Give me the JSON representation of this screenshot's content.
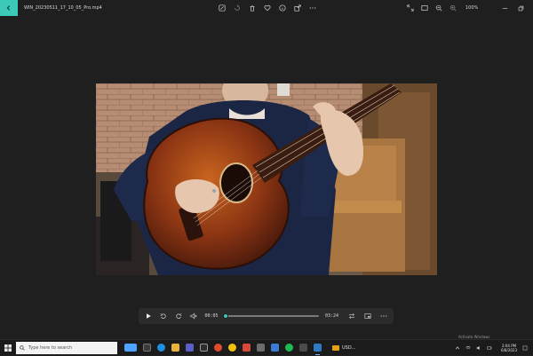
{
  "titlebar": {
    "back_icon": "arrow-left-icon",
    "filename": "WIN_20230511_17_10_05_Pro.mp4",
    "zoom_label": "100%"
  },
  "video": {
    "description_colors": {
      "brick": "#b3876c",
      "sweater": "#1d2a4a",
      "guitar": "#8a3a17",
      "piano": "#9c6b3f"
    }
  },
  "controls": {
    "current_time": "00:05",
    "total_time": "03:24",
    "progress": 0.025
  },
  "watermark": "Activate Windows",
  "taskbar": {
    "search_placeholder": "Type here to search",
    "stock_label": "USD...",
    "time": "2:04 PM",
    "date": "6/8/2023"
  },
  "colors": {
    "accent": "#3cc9b7",
    "background": "#1f1f1f"
  }
}
